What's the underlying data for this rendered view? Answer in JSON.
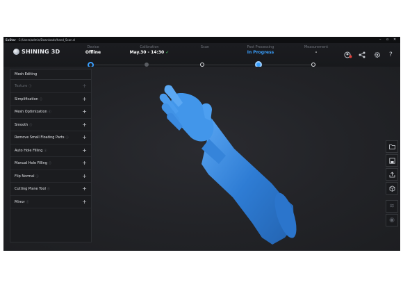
{
  "window": {
    "app_name": "ExStar",
    "path": "C:/Users/admin/Downloads/hand_Scan.sl"
  },
  "brand": {
    "name": "SHINING 3D"
  },
  "steps": [
    {
      "label": "Device",
      "value": "Offline",
      "state": "done"
    },
    {
      "label": "Calibration",
      "value": "May.30 - 14:30",
      "check": "✓",
      "state": "done"
    },
    {
      "label": "Scan",
      "value": "",
      "state": "done"
    },
    {
      "label": "Post Processing",
      "value": "In Progress",
      "state": "active"
    },
    {
      "label": "Measurement",
      "value": "-",
      "state": "todo"
    }
  ],
  "panel": {
    "title": "Mesh Editing",
    "items": [
      {
        "label": "Texture",
        "enabled": false
      },
      {
        "label": "Simplification",
        "enabled": true
      },
      {
        "label": "Mesh Optimization",
        "enabled": true
      },
      {
        "label": "Smooth",
        "enabled": true
      },
      {
        "label": "Remove Small Floating Parts",
        "enabled": true
      },
      {
        "label": "Auto Hole Filling",
        "enabled": true
      },
      {
        "label": "Manual Hole Filling",
        "enabled": true
      },
      {
        "label": "Flip Normal",
        "enabled": true
      },
      {
        "label": "Cutting Plane Tool",
        "enabled": true
      },
      {
        "label": "Mirror",
        "enabled": true
      }
    ]
  },
  "icons": {
    "header": [
      "user-icon",
      "share-icon",
      "settings-icon",
      "help-icon"
    ],
    "right_tools": [
      "folder-icon",
      "save-icon",
      "export-icon",
      "view-cube-icon",
      "layers-icon",
      "eye-icon"
    ]
  },
  "colors": {
    "accent": "#3aa0ff",
    "mesh": "#2f7fd6",
    "background": "#1f2024",
    "active_tool": "#1f5fa8"
  }
}
